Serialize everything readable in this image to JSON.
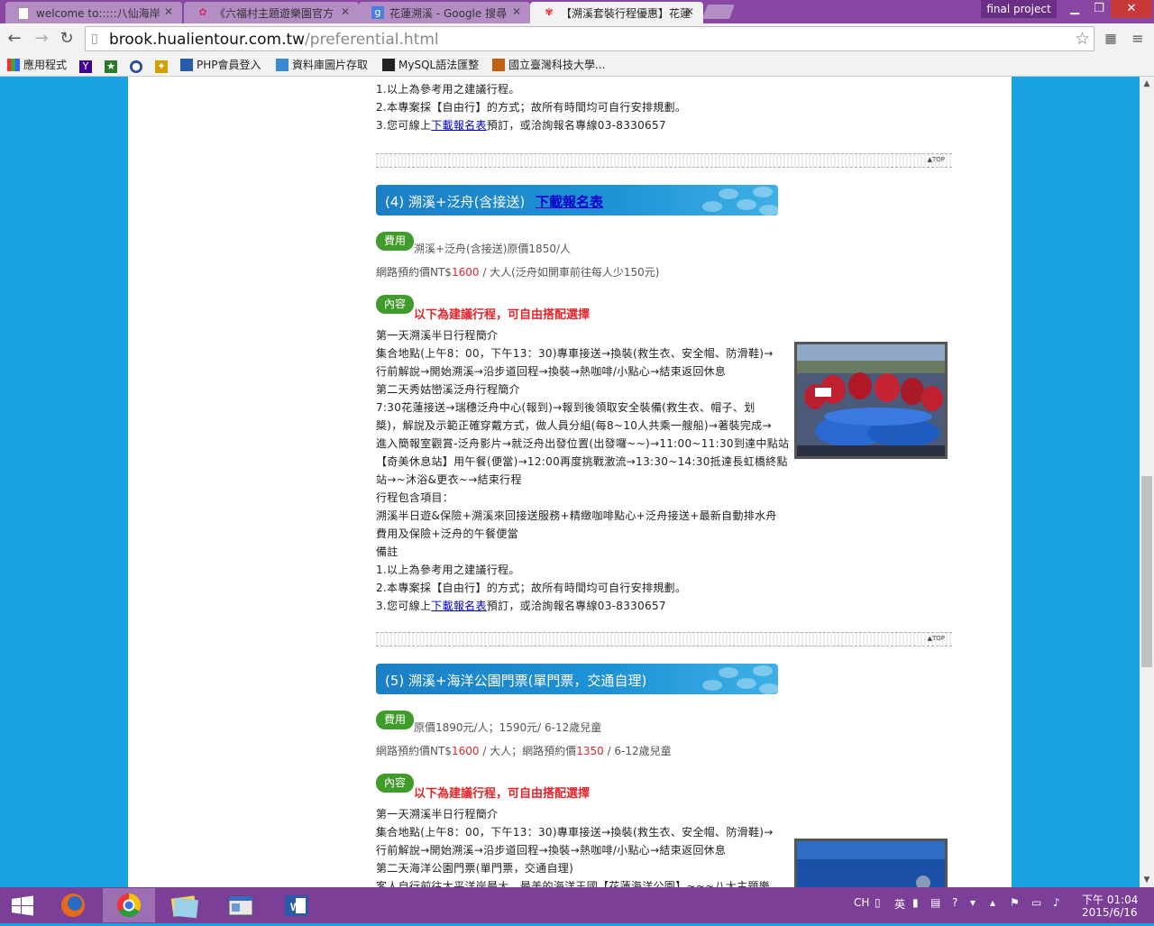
{
  "browser": {
    "tabs": [
      {
        "title": "welcome to:::::八仙海岸",
        "icon": "page-icon",
        "active": false
      },
      {
        "title": "《六福村主題遊樂園官方",
        "icon": "flower-icon",
        "active": false
      },
      {
        "title": "花蓮溯溪 - Google 搜尋",
        "icon": "google-icon",
        "active": false
      },
      {
        "title": "【溯溪套裝行程優惠】花蓮",
        "icon": "flower-icon",
        "active": true
      }
    ],
    "profile": "final project",
    "url_host": "brook.hualientour.com.tw",
    "url_path": "/preferential.html",
    "bookmarks": [
      {
        "label": "應用程式",
        "icon": "apps-icon"
      },
      {
        "label": "",
        "icon": "yahoo-icon"
      },
      {
        "label": "",
        "icon": "bookmark-icon"
      },
      {
        "label": "",
        "icon": "bookmark-icon"
      },
      {
        "label": "",
        "icon": "bookmark-icon"
      },
      {
        "label": "PHP會員登入",
        "icon": "folder-icon"
      },
      {
        "label": "資料庫圖片存取",
        "icon": "folder-icon"
      },
      {
        "label": "MySQL語法匯整",
        "icon": "folder-icon"
      },
      {
        "label": "國立臺灣科技大學...",
        "icon": "folder-icon"
      }
    ]
  },
  "page": {
    "top_block": {
      "line1": "1.以上為參考用之建議行程。",
      "line2": "2.本專案採【自由行】的方式；故所有時間均可自行安排規劃。",
      "line3_pre": "3.您可線上",
      "line3_link": "下載報名表",
      "line3_post": "預訂，或洽詢報名專線03-8330657"
    },
    "top_link": "TOP",
    "section4": {
      "title": "(4) 溯溪+泛舟(含接送)",
      "download": "下載報名表",
      "fee_badge": "費用",
      "fee_text": "溯溪+泛舟(含接送)原價1850/人",
      "price_pre": "網路預約價NT$",
      "price_red": "1600",
      "price_post": " / 大人(泛舟如開車前往每人少150元)",
      "content_badge": "內容",
      "highlight": "以下為建議行程，可自由搭配選擇",
      "lines": [
        "第一天溯溪半日行程簡介",
        "集合地點(上午8：00，下午13：30)專車接送→換裝(救生衣、安全帽、防滑鞋)→",
        "行前解說→開始溯溪→沿步道回程→換裝→熱咖啡/小點心→結束返回休息",
        "第二天秀姑巒溪泛舟行程簡介",
        "7:30花蓮接送→瑞穗泛舟中心(報到)→報到後領取安全裝備(救生衣、帽子、划",
        "槳)，解說及示範正確穿戴方式，做人員分組(每8~10人共乘一艘船)→著裝完成→",
        "進入簡報室觀賞-泛舟影片→就泛舟出發位置(出發囉~~)→11:00~11:30到達中點站",
        "【奇美休息站】用午餐(便當)→12:00再度挑戰激流→13:30~14:30抵達長虹橋終點",
        "站→~沐浴&更衣~→結束行程",
        "行程包含項目：",
        "溯溪半日遊&保險+溯溪來回接送服務+精緻咖啡點心+泛舟接送+最新自動排水舟",
        "費用及保險+泛舟的午餐便當",
        "備註",
        "1.以上為參考用之建議行程。",
        "2.本專案採【自由行】的方式；故所有時間均可自行安排規劃。"
      ],
      "last_pre": "3.您可線上",
      "last_link": "下載報名表",
      "last_post": "預訂，或洽詢報名專線03-8330657"
    },
    "section5": {
      "title": "(5) 溯溪+海洋公園門票(單門票，交通自理)",
      "fee_badge": "費用",
      "fee_text": "原價1890元/人；1590元/ 6-12歲兒童",
      "price_pre": "網路預約價NT$",
      "price_red": "1600",
      "price_mid": " / 大人；網路預約價",
      "price_red2": "1350",
      "price_post": " / 6-12歲兒童",
      "content_badge": "內容",
      "highlight": "以下為建議行程，可自由搭配選擇",
      "lines": [
        "第一天溯溪半日行程簡介",
        "集合地點(上午8：00，下午13：30)專車接送→換裝(救生衣、安全帽、防滑鞋)→",
        "行前解說→開始溯溪→沿步道回程→換裝→熱咖啡/小點心→結束返回休息",
        "第二天海洋公園門票(單門票，交通自理)",
        "客人自行前往太平洋岸最大、最美的海洋王國【花蓮海洋公園】~~~八大主題樂"
      ]
    }
  },
  "taskbar": {
    "apps": [
      "windows-start-icon",
      "firefox-icon",
      "chrome-icon",
      "file-explorer-icon",
      "notepad-icon",
      "word-icon"
    ],
    "lang": "CH",
    "time": "下午 01:04",
    "date": "2015/6/16"
  },
  "colors": {
    "titlebar": "#8a46a3",
    "page_bg": "#1aa3e0",
    "badge_green": "#3f9b2a",
    "highlight_red": "#e0262a",
    "taskbar": "#7b3f98"
  }
}
